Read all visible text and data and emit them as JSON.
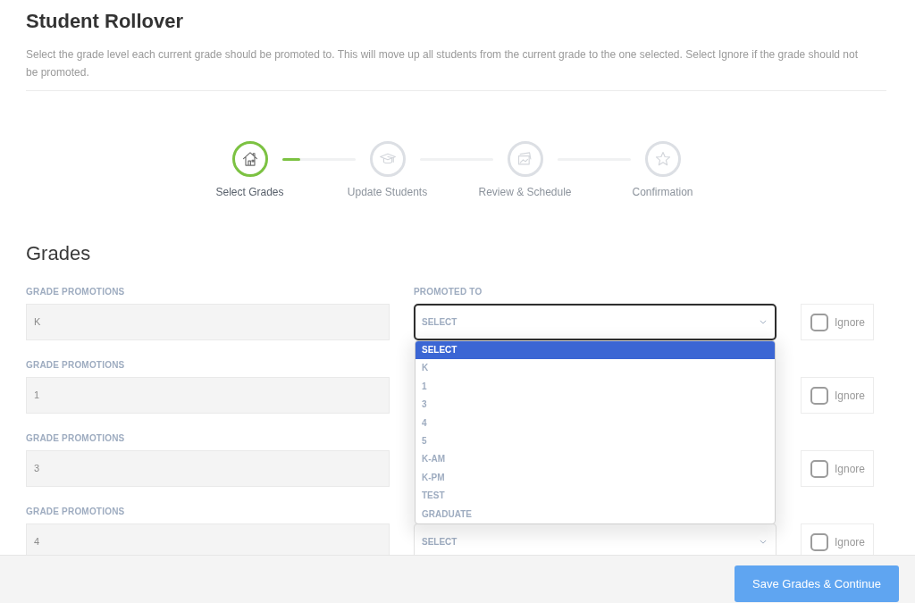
{
  "page": {
    "title": "Student Rollover",
    "description": "Select the grade level each current grade should be promoted to. This will move up all students from the current grade to the one selected. Select Ignore if the grade should not be promoted."
  },
  "stepper": {
    "steps": [
      {
        "label": "Select Grades",
        "selected": true
      },
      {
        "label": "Update Students",
        "selected": false
      },
      {
        "label": "Review & Schedule",
        "selected": false
      },
      {
        "label": "Confirmation",
        "selected": false
      }
    ],
    "connectors": [
      {
        "level": 0.25
      }
    ]
  },
  "grades": {
    "heading": "Grades",
    "rows": [
      {
        "label": "GRADE PROMOTIONS",
        "value": "K",
        "target": {
          "label": "PROMOTED TO",
          "value": "SELECT",
          "focused": true,
          "open": true,
          "options": [
            {
              "label": "SELECT",
              "selected": true
            },
            {
              "label": "K",
              "selected": false
            },
            {
              "label": "1",
              "selected": false
            },
            {
              "label": "3",
              "selected": false
            },
            {
              "label": "4",
              "selected": false
            },
            {
              "label": "5",
              "selected": false
            },
            {
              "label": "K-AM",
              "selected": false
            },
            {
              "label": "K-PM",
              "selected": false
            },
            {
              "label": "TEST",
              "selected": false
            },
            {
              "label": "GRADUATE",
              "selected": false
            }
          ]
        },
        "ignore": {
          "label": "Ignore",
          "checked": false
        }
      },
      {
        "label": "GRADE PROMOTIONS",
        "value": "1",
        "ignore": {
          "label": "Ignore",
          "checked": false
        }
      },
      {
        "label": "GRADE PROMOTIONS",
        "value": "3",
        "ignore": {
          "label": "Ignore",
          "checked": false
        }
      },
      {
        "label": "GRADE PROMOTIONS",
        "value": "4",
        "target": {
          "value": "SELECT",
          "focused": false,
          "open": false
        },
        "ignore": {
          "label": "Ignore",
          "checked": false
        }
      }
    ]
  },
  "footer": {
    "button": "Save Grades & Continue"
  }
}
